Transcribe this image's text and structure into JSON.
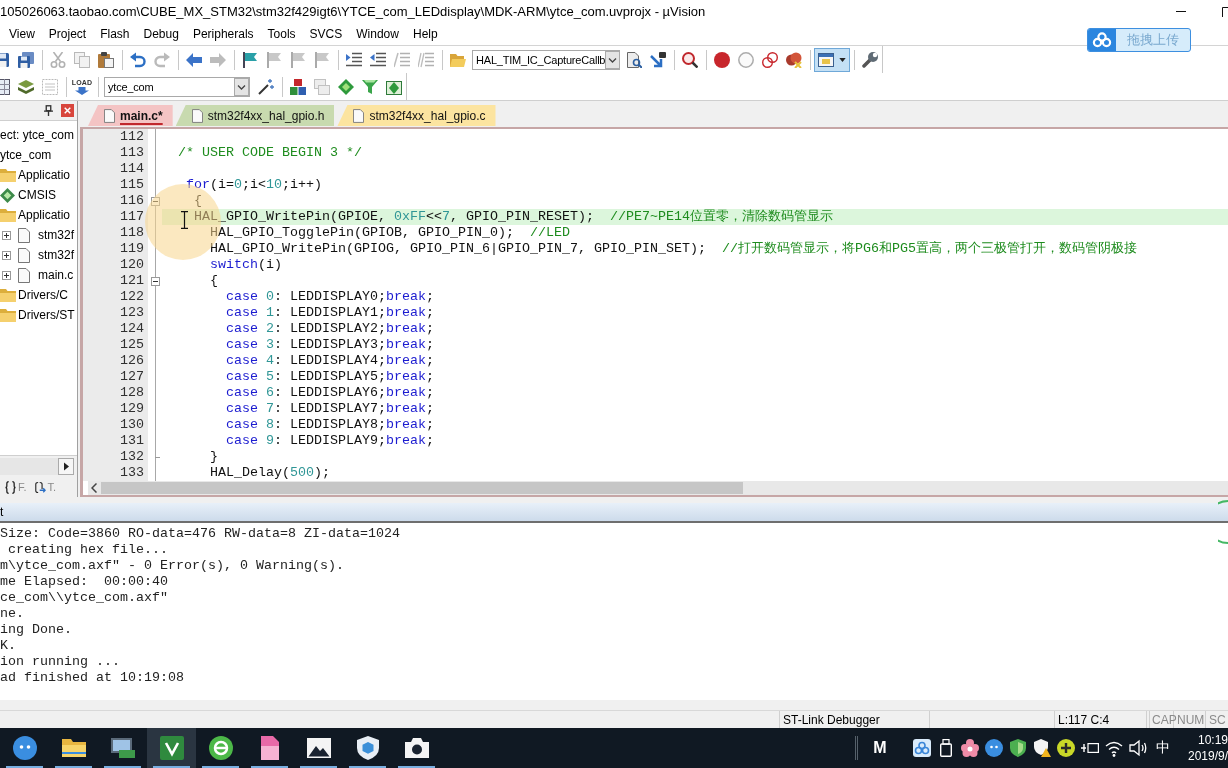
{
  "window": {
    "title": "105026063.taobao.com\\CUBE_MX_STM32\\stm32f429igt6\\YTCE_com_LEDdisplay\\MDK-ARM\\ytce_com.uvprojx - µVision"
  },
  "menu": [
    "View",
    "Project",
    "Flash",
    "Debug",
    "Peripherals",
    "Tools",
    "SVCS",
    "Window",
    "Help"
  ],
  "upload_widget": {
    "label": "拖拽上传"
  },
  "toolbar_1": [
    [
      {
        "kind": "button",
        "disabled": false,
        "selected": false
      },
      {
        "kind": "button",
        "disabled": false,
        "selected": false
      }
    ],
    [
      {
        "kind": "button",
        "disabled": true,
        "selected": false
      },
      {
        "kind": "button",
        "disabled": true,
        "selected": false
      },
      {
        "kind": "button",
        "disabled": false,
        "selected": false
      }
    ],
    [
      {
        "kind": "button",
        "disabled": false,
        "selected": false
      },
      {
        "kind": "button",
        "disabled": true,
        "selected": false
      }
    ],
    [
      {
        "kind": "button",
        "disabled": false,
        "selected": false
      },
      {
        "kind": "button",
        "disabled": true,
        "selected": false
      }
    ],
    [
      {
        "kind": "button",
        "disabled": false,
        "selected": false
      },
      {
        "kind": "button",
        "disabled": true,
        "selected": false
      },
      {
        "kind": "button",
        "disabled": true,
        "selected": false
      },
      {
        "kind": "button",
        "disabled": true,
        "selected": false
      }
    ],
    [
      {
        "kind": "button",
        "disabled": false,
        "selected": false
      },
      {
        "kind": "button",
        "disabled": false,
        "selected": false
      },
      {
        "kind": "button",
        "disabled": true,
        "selected": false
      },
      {
        "kind": "button",
        "disabled": true,
        "selected": false
      }
    ],
    [
      {
        "kind": "button",
        "disabled": false,
        "selected": false
      },
      {
        "kind": "dropdown",
        "value": "HAL_TIM_IC_CaptureCallb"
      },
      {
        "kind": "button",
        "disabled": false,
        "selected": false
      },
      {
        "kind": "button",
        "disabled": false,
        "selected": false
      }
    ],
    [
      {
        "kind": "button",
        "disabled": false,
        "selected": false
      }
    ],
    [
      {
        "kind": "button",
        "disabled": false,
        "selected": false
      },
      {
        "kind": "button",
        "disabled": true,
        "selected": false
      },
      {
        "kind": "button",
        "disabled": false,
        "selected": false
      },
      {
        "kind": "button",
        "disabled": false,
        "selected": false
      }
    ],
    [
      {
        "kind": "menu_button",
        "disabled": false,
        "selected": true
      }
    ],
    [
      {
        "kind": "button",
        "disabled": false,
        "selected": false
      }
    ]
  ],
  "toolbar_2": [
    [
      {
        "kind": "button",
        "disabled": false,
        "selected": false
      },
      {
        "kind": "button",
        "disabled": false,
        "selected": false
      },
      {
        "kind": "button",
        "disabled": true,
        "selected": false
      }
    ],
    [
      {
        "kind": "button",
        "label": "LOAD",
        "disabled": false,
        "selected": false
      }
    ],
    [
      {
        "kind": "dropdown",
        "value": "ytce_com"
      },
      {
        "kind": "button",
        "disabled": false,
        "selected": false
      }
    ],
    [
      {
        "kind": "button",
        "disabled": false,
        "selected": false
      },
      {
        "kind": "button",
        "disabled": true,
        "selected": false
      },
      {
        "kind": "button",
        "disabled": false,
        "selected": false
      },
      {
        "kind": "button",
        "disabled": false,
        "selected": false
      },
      {
        "kind": "button",
        "disabled": false,
        "selected": false
      }
    ]
  ],
  "project_panel": {
    "tree": [
      {
        "label": "ect: ytce_com",
        "children": [
          {
            "label": "ytce_com",
            "children": [
              {
                "label": "Applicatio",
                "kind": "folder"
              },
              {
                "label": "CMSIS",
                "kind": "component"
              },
              {
                "label": "Applicatio",
                "kind": "folder",
                "children": [
                  {
                    "label": "stm32f",
                    "kind": "file",
                    "expanded": false
                  },
                  {
                    "label": "stm32f",
                    "kind": "file",
                    "expanded": false
                  },
                  {
                    "label": "main.c",
                    "kind": "file",
                    "expanded": false
                  }
                ]
              },
              {
                "label": "Drivers/C",
                "kind": "folder"
              },
              {
                "label": "Drivers/ST",
                "kind": "folder"
              }
            ]
          }
        ]
      }
    ],
    "tabs": [
      {
        "label": "F.",
        "selected": false
      },
      {
        "label": "T.",
        "selected": false
      }
    ]
  },
  "editor": {
    "tabs": [
      {
        "label": "main.c*",
        "selected": true,
        "color": "#f4c4c4"
      },
      {
        "label": "stm32f4xx_hal_gpio.h",
        "selected": false,
        "color": "#c8daaf"
      },
      {
        "label": "stm32f4xx_hal_gpio.c",
        "selected": false,
        "color": "#fce4a0"
      }
    ],
    "lines": [
      {
        "number": "112",
        "highlighted": false,
        "collapsible": false,
        "block_end": false
      },
      {
        "number": "113",
        "highlighted": false,
        "collapsible": false,
        "block_end": false,
        "segments": [
          {
            "kind": "comment",
            "text": "  /* USER CODE BEGIN 3 */"
          }
        ]
      },
      {
        "number": "114",
        "highlighted": false,
        "collapsible": false,
        "block_end": false
      },
      {
        "number": "115",
        "highlighted": false,
        "collapsible": false,
        "block_end": false,
        "segments": [
          {
            "kind": "keyword",
            "text": "   for"
          },
          {
            "kind": "plain",
            "text": "(i="
          },
          {
            "kind": "number",
            "text": "0"
          },
          {
            "kind": "plain",
            "text": ";i<"
          },
          {
            "kind": "number",
            "text": "10"
          },
          {
            "kind": "plain",
            "text": ";i++)"
          }
        ]
      },
      {
        "number": "116",
        "highlighted": false,
        "collapsible": true,
        "block_end": false,
        "segments": [
          {
            "kind": "plain",
            "text": "    {"
          }
        ]
      },
      {
        "number": "117",
        "highlighted": true,
        "collapsible": false,
        "block_end": false,
        "segments": [
          {
            "kind": "plain",
            "text": "    HAL_GPIO_WritePin(GPIOE, "
          },
          {
            "kind": "number",
            "text": "0xFF"
          },
          {
            "kind": "plain",
            "text": "<<"
          },
          {
            "kind": "number",
            "text": "7"
          },
          {
            "kind": "plain",
            "text": ", GPIO_PIN_RESET);  "
          },
          {
            "kind": "comment",
            "text": "//PE7~PE14位置零，清除数码管显示"
          }
        ]
      },
      {
        "number": "118",
        "highlighted": false,
        "collapsible": false,
        "block_end": false,
        "segments": [
          {
            "kind": "plain",
            "text": "      HAL_GPIO_TogglePin(GPIOB, GPIO_PIN_0);  "
          },
          {
            "kind": "comment",
            "text": "//LED"
          }
        ]
      },
      {
        "number": "119",
        "highlighted": false,
        "collapsible": false,
        "block_end": false,
        "segments": [
          {
            "kind": "plain",
            "text": "      HAL_GPIO_WritePin(GPIOG, GPIO_PIN_6|GPIO_PIN_7, GPIO_PIN_SET);  "
          },
          {
            "kind": "comment",
            "text": "//打开数码管显示，将PG6和PG5置高，两个三极管打开，数码管阴极接"
          }
        ]
      },
      {
        "number": "120",
        "highlighted": false,
        "collapsible": false,
        "block_end": false,
        "segments": [
          {
            "kind": "keyword",
            "text": "      switch"
          },
          {
            "kind": "plain",
            "text": "(i)"
          }
        ]
      },
      {
        "number": "121",
        "highlighted": false,
        "collapsible": true,
        "block_end": false,
        "segments": [
          {
            "kind": "plain",
            "text": "      {"
          }
        ]
      },
      {
        "number": "122",
        "highlighted": false,
        "collapsible": false,
        "block_end": false,
        "segments": [
          {
            "kind": "keyword",
            "text": "        case"
          },
          {
            "kind": "number",
            "text": " 0"
          },
          {
            "kind": "plain",
            "text": ": LEDDISPLAY0;"
          },
          {
            "kind": "keyword",
            "text": "break"
          },
          {
            "kind": "plain",
            "text": ";"
          }
        ]
      },
      {
        "number": "123",
        "highlighted": false,
        "collapsible": false,
        "block_end": false,
        "segments": [
          {
            "kind": "keyword",
            "text": "        case"
          },
          {
            "kind": "number",
            "text": " 1"
          },
          {
            "kind": "plain",
            "text": ": LEDDISPLAY1;"
          },
          {
            "kind": "keyword",
            "text": "break"
          },
          {
            "kind": "plain",
            "text": ";"
          }
        ]
      },
      {
        "number": "124",
        "highlighted": false,
        "collapsible": false,
        "block_end": false,
        "segments": [
          {
            "kind": "keyword",
            "text": "        case"
          },
          {
            "kind": "number",
            "text": " 2"
          },
          {
            "kind": "plain",
            "text": ": LEDDISPLAY2;"
          },
          {
            "kind": "keyword",
            "text": "break"
          },
          {
            "kind": "plain",
            "text": ";"
          }
        ]
      },
      {
        "number": "125",
        "highlighted": false,
        "collapsible": false,
        "block_end": false,
        "segments": [
          {
            "kind": "keyword",
            "text": "        case"
          },
          {
            "kind": "number",
            "text": " 3"
          },
          {
            "kind": "plain",
            "text": ": LEDDISPLAY3;"
          },
          {
            "kind": "keyword",
            "text": "break"
          },
          {
            "kind": "plain",
            "text": ";"
          }
        ]
      },
      {
        "number": "126",
        "highlighted": false,
        "collapsible": false,
        "block_end": false,
        "segments": [
          {
            "kind": "keyword",
            "text": "        case"
          },
          {
            "kind": "number",
            "text": " 4"
          },
          {
            "kind": "plain",
            "text": ": LEDDISPLAY4;"
          },
          {
            "kind": "keyword",
            "text": "break"
          },
          {
            "kind": "plain",
            "text": ";"
          }
        ]
      },
      {
        "number": "127",
        "highlighted": false,
        "collapsible": false,
        "block_end": false,
        "segments": [
          {
            "kind": "keyword",
            "text": "        case"
          },
          {
            "kind": "number",
            "text": " 5"
          },
          {
            "kind": "plain",
            "text": ": LEDDISPLAY5;"
          },
          {
            "kind": "keyword",
            "text": "break"
          },
          {
            "kind": "plain",
            "text": ";"
          }
        ]
      },
      {
        "number": "128",
        "highlighted": false,
        "collapsible": false,
        "block_end": false,
        "segments": [
          {
            "kind": "keyword",
            "text": "        case"
          },
          {
            "kind": "number",
            "text": " 6"
          },
          {
            "kind": "plain",
            "text": ": LEDDISPLAY6;"
          },
          {
            "kind": "keyword",
            "text": "break"
          },
          {
            "kind": "plain",
            "text": ";"
          }
        ]
      },
      {
        "number": "129",
        "highlighted": false,
        "collapsible": false,
        "block_end": false,
        "segments": [
          {
            "kind": "keyword",
            "text": "        case"
          },
          {
            "kind": "number",
            "text": " 7"
          },
          {
            "kind": "plain",
            "text": ": LEDDISPLAY7;"
          },
          {
            "kind": "keyword",
            "text": "break"
          },
          {
            "kind": "plain",
            "text": ";"
          }
        ]
      },
      {
        "number": "130",
        "highlighted": false,
        "collapsible": false,
        "block_end": false,
        "segments": [
          {
            "kind": "keyword",
            "text": "        case"
          },
          {
            "kind": "number",
            "text": " 8"
          },
          {
            "kind": "plain",
            "text": ": LEDDISPLAY8;"
          },
          {
            "kind": "keyword",
            "text": "break"
          },
          {
            "kind": "plain",
            "text": ";"
          }
        ]
      },
      {
        "number": "131",
        "highlighted": false,
        "collapsible": false,
        "block_end": false,
        "segments": [
          {
            "kind": "keyword",
            "text": "        case"
          },
          {
            "kind": "number",
            "text": " 9"
          },
          {
            "kind": "plain",
            "text": ": LEDDISPLAY9;"
          },
          {
            "kind": "keyword",
            "text": "break"
          },
          {
            "kind": "plain",
            "text": ";"
          }
        ]
      },
      {
        "number": "132",
        "highlighted": false,
        "collapsible": false,
        "block_end": true,
        "segments": [
          {
            "kind": "plain",
            "text": "      }"
          }
        ]
      },
      {
        "number": "133",
        "highlighted": false,
        "collapsible": false,
        "block_end": false,
        "segments": [
          {
            "kind": "plain",
            "text": "      HAL_Delay("
          },
          {
            "kind": "number",
            "text": "500"
          },
          {
            "kind": "plain",
            "text": ");"
          }
        ]
      }
    ]
  },
  "output": {
    "title": "t",
    "lines": [
      "Size: Code=3860 RO-data=476 RW-data=8 ZI-data=1024",
      " creating hex file...",
      "m\\ytce_com.axf\" - 0 Error(s), 0 Warning(s).",
      "me Elapsed:  00:00:40",
      "ce_com\\\\ytce_com.axf\"",
      "ne.",
      "ing Done.",
      "K.",
      "ion running ...",
      "ad finished at 10:19:08"
    ]
  },
  "status_bar": {
    "debugger": "ST-Link Debugger",
    "position": "L:117 C:4",
    "indicators": [
      {
        "label": "CAP",
        "on": false
      },
      {
        "label": "NUM",
        "on": false
      },
      {
        "label": "SC",
        "on": false
      }
    ]
  },
  "taskbar": {
    "apps": [
      {
        "selected": false,
        "running": true
      },
      {
        "selected": false,
        "running": true
      },
      {
        "selected": false,
        "running": true
      },
      {
        "selected": true,
        "running": true
      },
      {
        "selected": false,
        "running": true
      },
      {
        "selected": false,
        "running": true
      },
      {
        "selected": false,
        "running": true
      },
      {
        "selected": false,
        "running": true
      },
      {
        "selected": false,
        "running": true
      }
    ],
    "tray": {
      "letter": "M",
      "input_method": "中",
      "time": "10:19",
      "date": "2019/9/"
    }
  }
}
